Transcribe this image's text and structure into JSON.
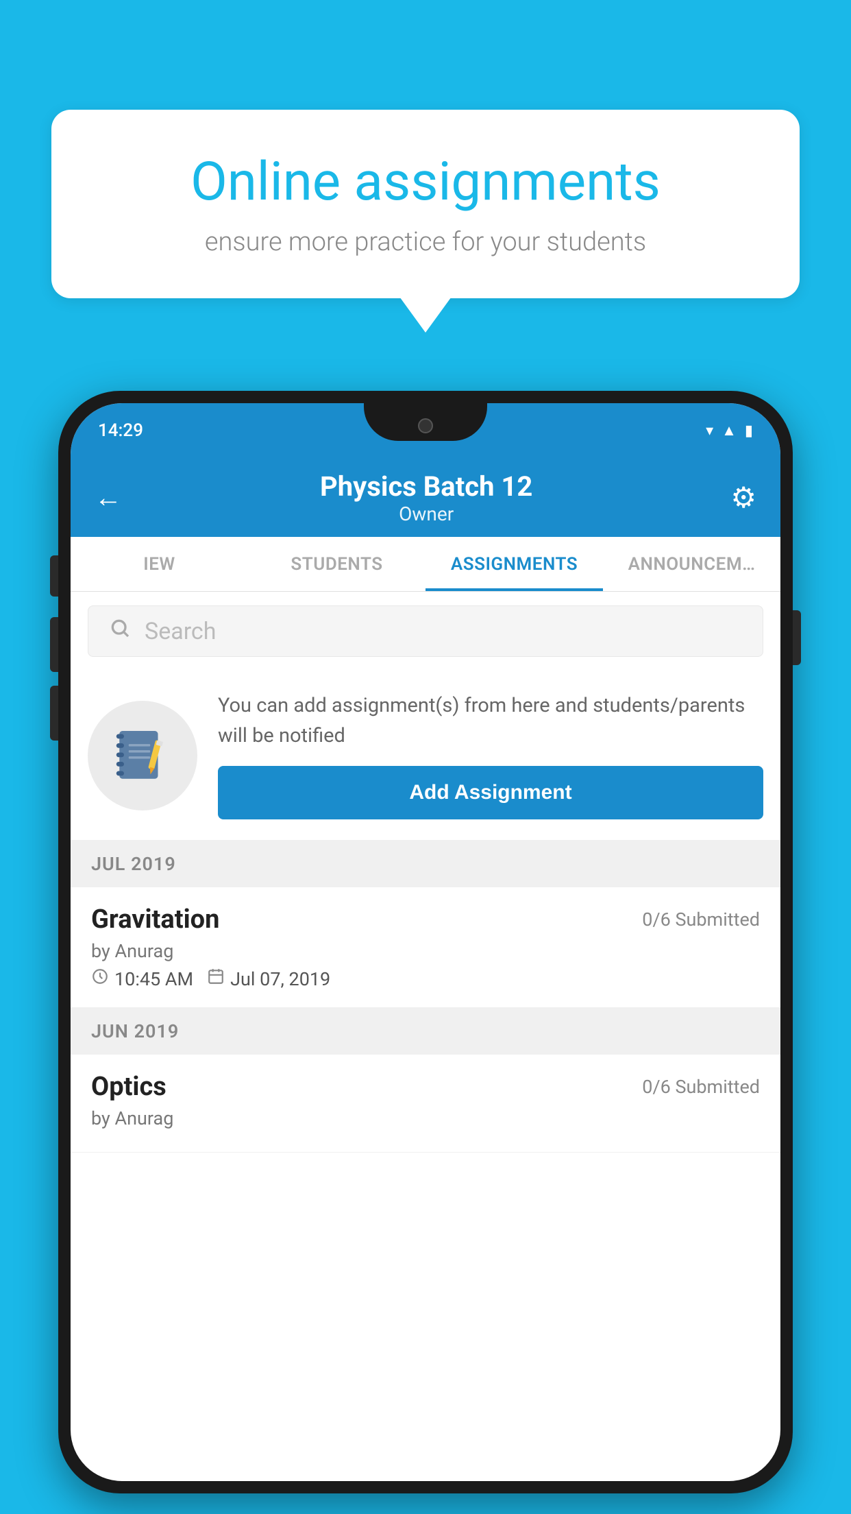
{
  "background_color": "#1ab8e8",
  "speech_bubble": {
    "title": "Online assignments",
    "subtitle": "ensure more practice for your students"
  },
  "phone": {
    "status_bar": {
      "time": "14:29",
      "icons": [
        "wifi",
        "signal",
        "battery"
      ]
    },
    "header": {
      "title": "Physics Batch 12",
      "subtitle": "Owner",
      "back_label": "←",
      "gear_label": "⚙"
    },
    "tabs": [
      {
        "label": "IEW",
        "active": false
      },
      {
        "label": "STUDENTS",
        "active": false
      },
      {
        "label": "ASSIGNMENTS",
        "active": true
      },
      {
        "label": "ANNOUNCEM…",
        "active": false
      }
    ],
    "search": {
      "placeholder": "Search"
    },
    "info_card": {
      "text": "You can add assignment(s) from here and students/parents will be notified",
      "button_label": "Add Assignment"
    },
    "sections": [
      {
        "label": "JUL 2019",
        "assignments": [
          {
            "name": "Gravitation",
            "submitted": "0/6 Submitted",
            "by": "by Anurag",
            "time": "10:45 AM",
            "date": "Jul 07, 2019"
          }
        ]
      },
      {
        "label": "JUN 2019",
        "assignments": [
          {
            "name": "Optics",
            "submitted": "0/6 Submitted",
            "by": "by Anurag",
            "time": "",
            "date": ""
          }
        ]
      }
    ]
  }
}
